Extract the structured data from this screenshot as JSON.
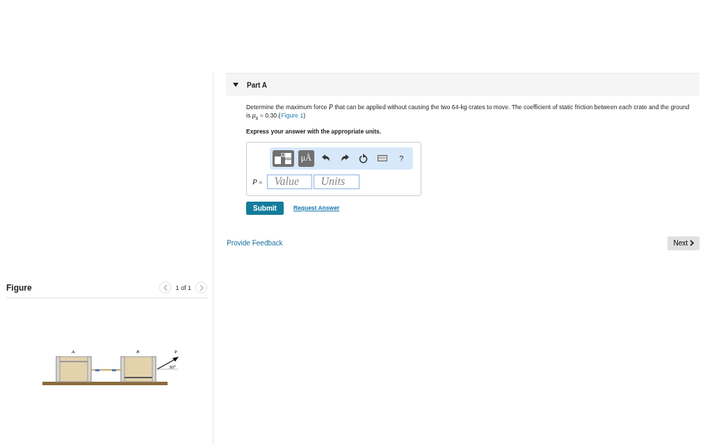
{
  "part": {
    "title": "Part A",
    "expanded": true
  },
  "question": {
    "before": "Determine the maximum force *P* that can be applied without causing the two 64-kg crates to move. The coefficient of static friction between each crate and the ground is *μ*$_{s}$ = 0.30.(",
    "link": "Figure 1",
    "after": ")"
  },
  "instruction": "Express your answer with the appropriate units.",
  "toolbar": [
    {
      "kind": "templates"
    },
    {
      "kind": "symbols",
      "label": "μÅ"
    },
    {
      "kind": "undo"
    },
    {
      "kind": "redo"
    },
    {
      "kind": "reset"
    },
    {
      "kind": "keyboard"
    },
    {
      "kind": "help",
      "label": "?"
    }
  ],
  "answer": {
    "variable": "P",
    "equals": "=",
    "value_placeholder": "Value",
    "units_placeholder": "Units"
  },
  "submit": "Submit",
  "request_answer": "Request Answer",
  "feedback": "Provide Feedback",
  "next": "Next",
  "figure": {
    "title": "Figure",
    "counter": "1 of 1",
    "labels": {
      "a": "A",
      "b": "B",
      "p": "P",
      "angle": "30°"
    }
  }
}
